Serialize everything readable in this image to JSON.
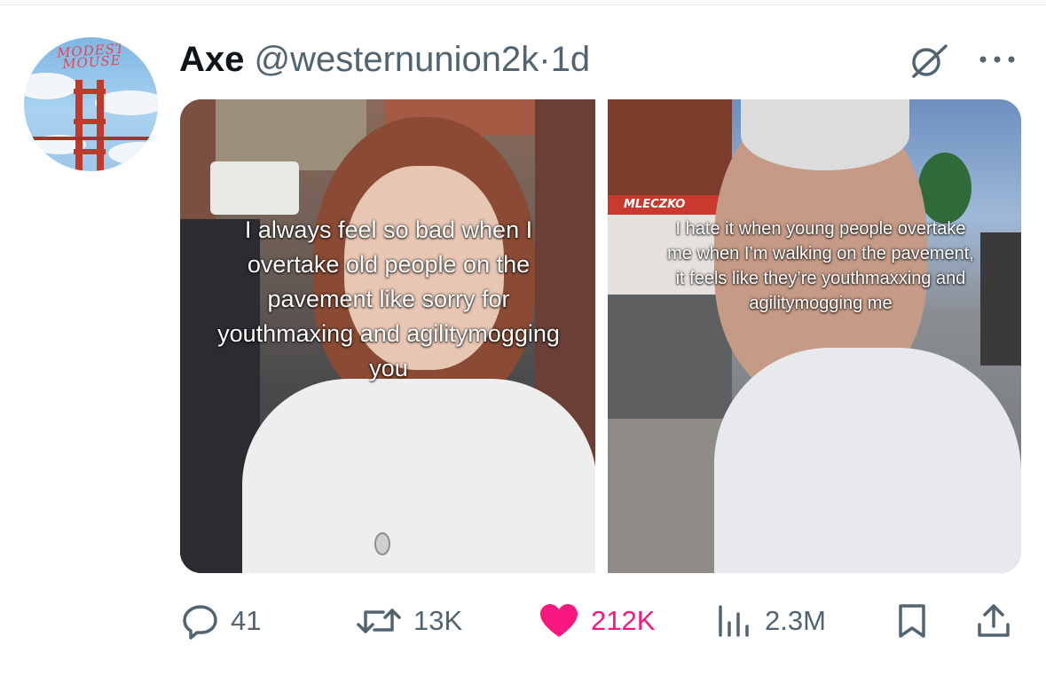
{
  "post": {
    "author_name": "Axe",
    "handle": "@westernunion2k",
    "separator": "·",
    "time": "1d",
    "avatar_logo_text": "MODEST MOUSE"
  },
  "media": {
    "left_caption": "I always feel so bad when I overtake old people on the pavement like sorry for youthmaxing and agilitymogging you",
    "right_caption": "I hate it when young people overtake me when I’m walking on the pavement, it feels like they’re youthmaxxing and agilitymogging me",
    "storefront_sign": "MLECZKO"
  },
  "actions": {
    "replies": "41",
    "reposts": "13K",
    "likes": "212K",
    "views": "2.3M"
  },
  "icons": [
    "grok-icon",
    "more-icon",
    "reply-icon",
    "repost-icon",
    "like-icon",
    "views-icon",
    "bookmark-icon",
    "share-icon"
  ],
  "colors": {
    "like": "#f91880",
    "muted": "#536471",
    "text": "#0f1419"
  }
}
